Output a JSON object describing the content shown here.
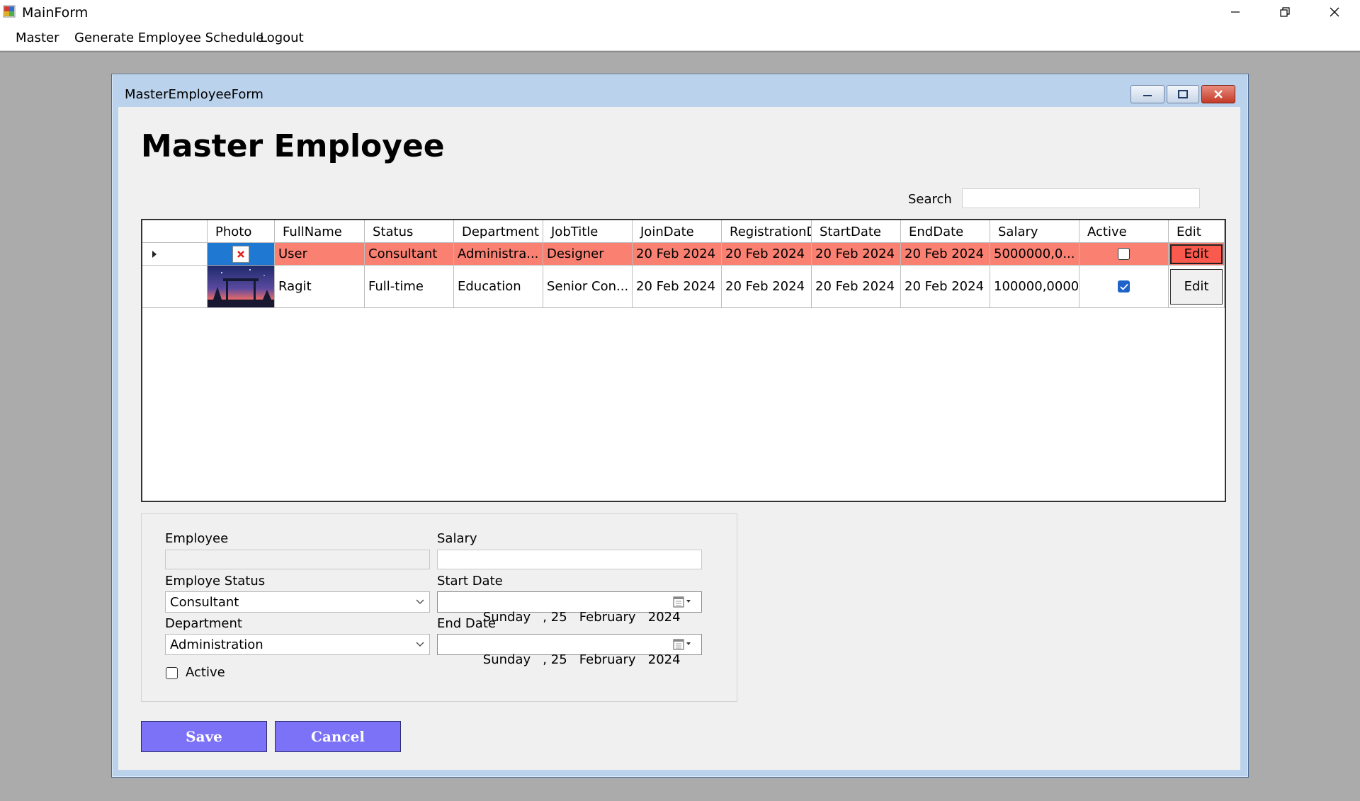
{
  "app": {
    "title": "MainForm"
  },
  "menu": [
    "Master",
    "Generate Employee Schedule",
    "Logout"
  ],
  "child_window": {
    "title": "MasterEmployeeForm"
  },
  "page": {
    "heading": "Master Employee"
  },
  "search": {
    "label": "Search",
    "value": ""
  },
  "grid": {
    "columns": [
      "Photo",
      "FullName",
      "Status",
      "Department",
      "JobTitle",
      "JoinDate",
      "RegistrationD",
      "StartDate",
      "EndDate",
      "Salary",
      "Active",
      "Edit"
    ],
    "rows": [
      {
        "fullname": "User",
        "status": "Consultant",
        "department": "Administra...",
        "jobtitle": "Designer",
        "joindate": "20 Feb 2024",
        "registration": "20 Feb 2024",
        "startdate": "20 Feb 2024",
        "enddate": "20 Feb 2024",
        "salary": "5000000,0...",
        "active": false,
        "edit": "Edit",
        "photo": "broken-image",
        "selected": true,
        "row_color": "#fa8072"
      },
      {
        "fullname": "Ragit",
        "status": "Full-time",
        "department": "Education",
        "jobtitle": "Senior Con...",
        "joindate": "20 Feb 2024",
        "registration": "20 Feb 2024",
        "startdate": "20 Feb 2024",
        "enddate": "20 Feb 2024",
        "salary": "100000,0000",
        "active": true,
        "edit": "Edit",
        "photo": "night-scene-thumbnail",
        "selected": false
      }
    ]
  },
  "form": {
    "employee_label": "Employee",
    "employee_value": "",
    "salary_label": "Salary",
    "salary_value": "",
    "status_label": "Employe Status",
    "status_value": "Consultant",
    "start_label": "Start Date",
    "start_value": "Sunday   , 25   February   2024",
    "department_label": "Department",
    "department_value": "Administration",
    "end_label": "End Date",
    "end_value": "Sunday   , 25   February   2024",
    "active_label": "Active",
    "active_checked": false
  },
  "buttons": {
    "save": "Save",
    "cancel": "Cancel"
  },
  "colors": {
    "button": "#7b72f7",
    "selected_row": "#fa8072",
    "checkbox_on": "#1f63c9"
  }
}
